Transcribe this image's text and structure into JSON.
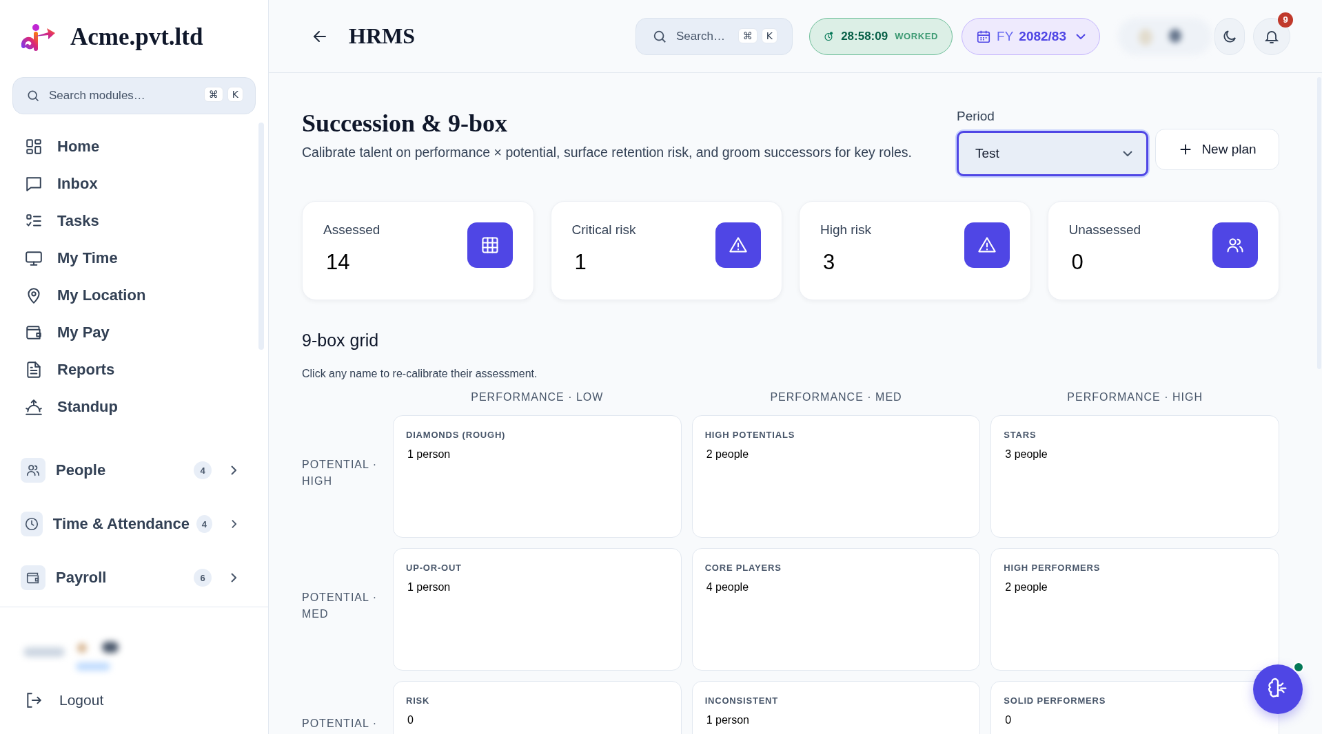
{
  "sidebar": {
    "brand": "Acme.pvt.ltd",
    "search": {
      "placeholder": "Search modules…",
      "keys": [
        "⌘",
        "K"
      ]
    },
    "items": [
      {
        "label": "Home"
      },
      {
        "label": "Inbox"
      },
      {
        "label": "Tasks"
      },
      {
        "label": "My Time"
      },
      {
        "label": "My Location"
      },
      {
        "label": "My Pay"
      },
      {
        "label": "Reports"
      },
      {
        "label": "Standup"
      }
    ],
    "groups": [
      {
        "label": "People",
        "badge": "4"
      },
      {
        "label": "Time & Attendance",
        "badge": "4"
      },
      {
        "label": "Payroll",
        "badge": "6"
      }
    ],
    "logout": "Logout"
  },
  "topbar": {
    "title": "HRMS",
    "search": {
      "placeholder": "Search…",
      "keys": [
        "⌘",
        "K"
      ]
    },
    "timer": {
      "time": "28:58:09",
      "label": "WORKED"
    },
    "fiscal_year": {
      "prefix": "FY",
      "value": "2082/83"
    },
    "notifications": "9"
  },
  "page": {
    "title": "Succession & 9-box",
    "subtitle": "Calibrate talent on performance × potential, surface retention risk, and groom successors for key roles.",
    "period": {
      "label": "Period",
      "value": "Test"
    },
    "new_plan": "New plan",
    "stats": [
      {
        "label": "Assessed",
        "value": "14"
      },
      {
        "label": "Critical risk",
        "value": "1"
      },
      {
        "label": "High risk",
        "value": "3"
      },
      {
        "label": "Unassessed",
        "value": "0"
      }
    ],
    "grid": {
      "title": "9-box grid",
      "hint": "Click any name to re-calibrate their assessment.",
      "columns": [
        "PERFORMANCE · LOW",
        "PERFORMANCE · MED",
        "PERFORMANCE · HIGH"
      ],
      "rows": [
        {
          "label": "POTENTIAL · HIGH",
          "cells": [
            {
              "title": "DIAMONDS (ROUGH)",
              "count": "1 person"
            },
            {
              "title": "HIGH POTENTIALS",
              "count": "2 people"
            },
            {
              "title": "STARS",
              "count": "3 people"
            }
          ]
        },
        {
          "label": "POTENTIAL · MED",
          "cells": [
            {
              "title": "UP-OR-OUT",
              "count": "1 person"
            },
            {
              "title": "CORE PLAYERS",
              "count": "4 people"
            },
            {
              "title": "HIGH PERFORMERS",
              "count": "2 people"
            }
          ]
        },
        {
          "label": "POTENTIAL ·",
          "cells": [
            {
              "title": "RISK",
              "count": "0"
            },
            {
              "title": "INCONSISTENT",
              "count": "1 person"
            },
            {
              "title": "SOLID PERFORMERS",
              "count": "0"
            }
          ]
        }
      ]
    }
  }
}
